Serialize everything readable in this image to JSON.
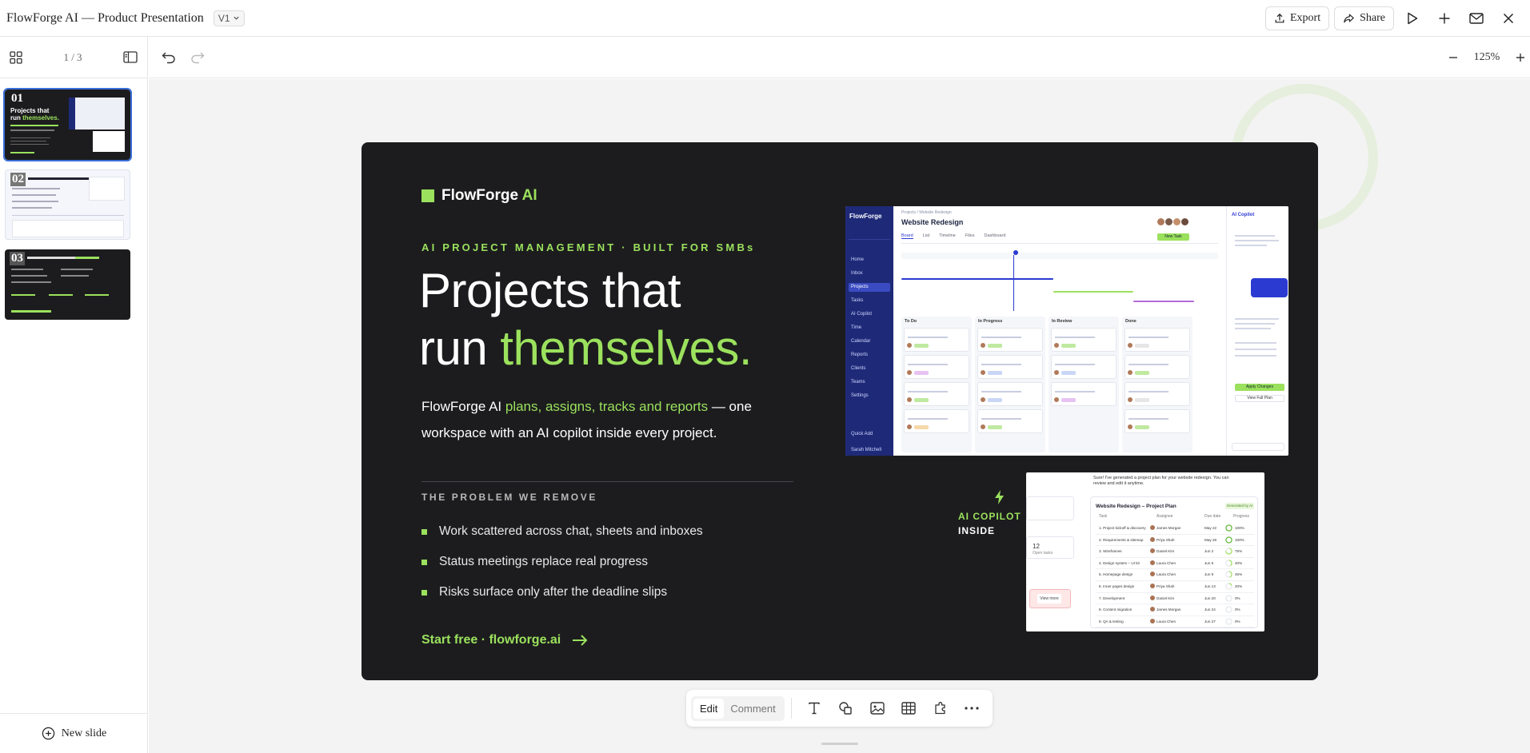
{
  "document": {
    "title": "FlowForge AI — Product Presentation",
    "version": "V1"
  },
  "topbar": {
    "export_label": "Export",
    "share_label": "Share"
  },
  "sidebar": {
    "page_indicator": "1 / 3",
    "new_slide_label": "New slide",
    "thumbnails": [
      {
        "number": "01",
        "active": true
      },
      {
        "number": "02",
        "active": false
      },
      {
        "number": "03",
        "active": false
      }
    ]
  },
  "zoom": {
    "level": "125%"
  },
  "slide": {
    "brand": {
      "name": "FlowForge",
      "accent": "AI"
    },
    "eyebrow": "AI PROJECT MANAGEMENT · BUILT FOR SMBs",
    "headline_line1": "Projects that",
    "headline_line2_plain": "run ",
    "headline_line2_highlight": "themselves.",
    "sub_prefix": "FlowForge AI ",
    "sub_highlight": "plans, assigns, tracks and reports",
    "sub_suffix": " — one workspace with an AI copilot inside every project.",
    "problem_title": "THE PROBLEM WE REMOVE",
    "problems": [
      "Work scattered across chat, sheets and inboxes",
      "Status meetings replace real progress",
      "Risks surface only after the deadline slips"
    ],
    "cta": "Start free · flowforge.ai",
    "badge_line1": "AI COPILOT",
    "badge_line2": "INSIDE",
    "dashboard": {
      "logo": "FlowForge",
      "breadcrumb": "Projects / Website Redesign",
      "title": "Website Redesign",
      "tabs": [
        "Board",
        "List",
        "Timeline",
        "Files",
        "Dashboard"
      ],
      "new_task": "New Task",
      "nav": [
        "Home",
        "Inbox",
        "Projects",
        "Tasks",
        "AI Copilot",
        "Time",
        "Calendar",
        "Reports",
        "Clients",
        "Teams",
        "Settings"
      ],
      "quick_add": "Quick Add",
      "user": "Sarah Mitchell",
      "columns": [
        "To Do",
        "In Progress",
        "In Review",
        "Done"
      ],
      "copilot_title": "AI Copilot",
      "apply_changes": "Apply Changes",
      "view_full_plan": "View Full Plan"
    },
    "plan": {
      "title": "Website Redesign – Project Plan",
      "badge": "Generated by AI",
      "headers": [
        "Task",
        "Assignee",
        "Due date",
        "Progress"
      ],
      "rows": [
        {
          "task": "1. Project kickoff & discovery",
          "assignee": "James Morgan",
          "due": "May 22",
          "progress": "100%"
        },
        {
          "task": "2. Requirements & sitemap",
          "assignee": "Priya Shah",
          "due": "May 26",
          "progress": "100%"
        },
        {
          "task": "3. Wireframes",
          "assignee": "Daniel Kim",
          "due": "Jun 2",
          "progress": "75%"
        },
        {
          "task": "4. Design system – UI kit",
          "assignee": "Laura Chen",
          "due": "Jun 6",
          "progress": "40%"
        },
        {
          "task": "5. Homepage design",
          "assignee": "Laura Chen",
          "due": "Jun 9",
          "progress": "45%"
        },
        {
          "task": "6. Inner pages design",
          "assignee": "Priya Shah",
          "due": "Jun 13",
          "progress": "20%"
        },
        {
          "task": "7. Development",
          "assignee": "Daniel Kim",
          "due": "Jun 20",
          "progress": "0%"
        },
        {
          "task": "8. Content migration",
          "assignee": "James Morgan",
          "due": "Jun 24",
          "progress": "0%"
        },
        {
          "task": "9. QA & testing",
          "assignee": "Laura Chen",
          "due": "Jun 27",
          "progress": "0%"
        }
      ],
      "note_line": "Sure! I've generated a project plan for your website redesign. You can review and edit it anytime.",
      "view_more": "View more",
      "open_tasks_count": "12",
      "open_tasks_label": "Open tasks"
    }
  },
  "floatbar": {
    "edit_label": "Edit",
    "comment_label": "Comment"
  },
  "colors": {
    "accent": "#9be15d",
    "slide_bg": "#1c1c1e",
    "nav_bg": "#1e2a78"
  }
}
